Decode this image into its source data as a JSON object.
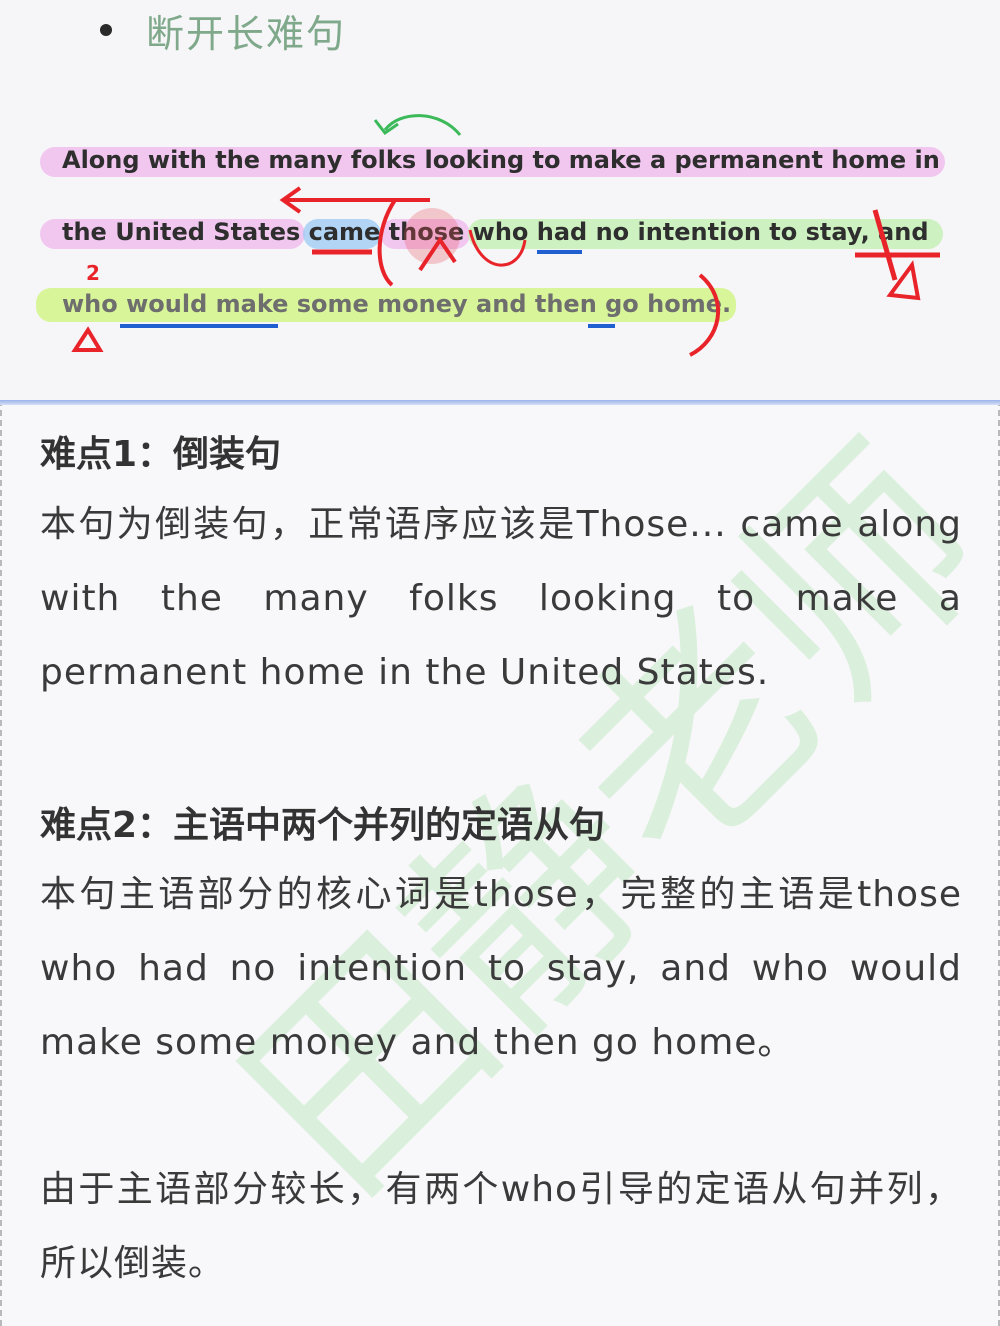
{
  "section": {
    "bullet_title": "断开长难句"
  },
  "sentence": {
    "line1": "Along with the many folks looking to make a permanent home in",
    "line2": "the United States came those who had no intention to stay, and",
    "line3": "who would make some money and then go home.",
    "annotation_number": "2"
  },
  "difficulty1": {
    "title": "难点1：倒装句",
    "text": "本句为倒装句，正常语序应该是Those... came along with the many folks looking to make a permanent home in the United States."
  },
  "difficulty2": {
    "title": "难点2：主语中两个并列的定语从句",
    "text": "本句主语部分的核心词是those，完整的主语是those who had no intention to stay, and who would make some money and then go home。",
    "text2": "由于主语部分较长，有两个who引导的定语从句并列，所以倒装。"
  },
  "watermark": "田静老师",
  "colors": {
    "pink_highlight": "#eca0e8",
    "green_highlight": "#bef0aa",
    "blue_highlight": "#96c8f5",
    "red_ink": "#e8242a",
    "green_ink": "#3cba5a",
    "blue_ink": "#1f5fd0",
    "bullet_title": "#7fa98a"
  }
}
